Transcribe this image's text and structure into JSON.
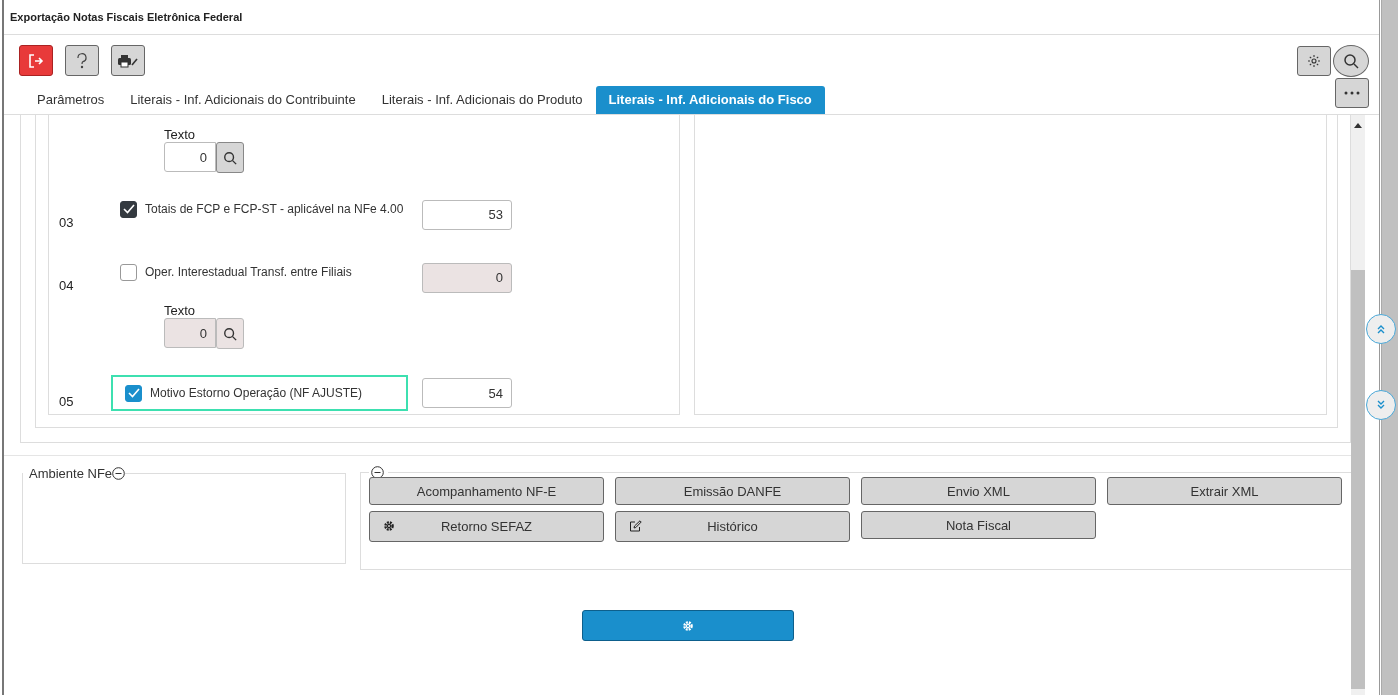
{
  "window": {
    "title": "Exportação Notas Fiscais Eletrônica Federal"
  },
  "tabs": [
    {
      "label": "Parâmetros",
      "selected": false
    },
    {
      "label": "Literais - Inf. Adicionais do Contribuinte",
      "selected": false
    },
    {
      "label": "Literais - Inf. Adicionais do Produto",
      "selected": false
    },
    {
      "label": "Literais - Inf. Adicionais do Fisco",
      "selected": true
    }
  ],
  "items": [
    {
      "kind": "texto",
      "label": "Texto",
      "value": "0",
      "disabled": false
    },
    {
      "kind": "option",
      "number": "03",
      "label": "Totais de FCP e FCP-ST - aplicável na NFe 4.00",
      "checked": true,
      "value": "53",
      "disabled": false,
      "focused": false
    },
    {
      "kind": "option",
      "number": "04",
      "label": "Oper. Interestadual Transf. entre Filiais",
      "checked": false,
      "value": "0",
      "disabled": true,
      "focused": false
    },
    {
      "kind": "texto",
      "label": "Texto",
      "value": "0",
      "disabled": true
    },
    {
      "kind": "option",
      "number": "05",
      "label": "Motivo Estorno Operação (NF AJUSTE)",
      "checked": true,
      "value": "54",
      "disabled": false,
      "focused": true
    }
  ],
  "ambiente": {
    "legend": "Ambiente NFe"
  },
  "actions": [
    {
      "label": "Acompanhamento NF-E",
      "kind": "plain"
    },
    {
      "label": "Emissão DANFE",
      "kind": "plain"
    },
    {
      "label": "Envio XML",
      "kind": "plain"
    },
    {
      "label": "Extrair XML",
      "kind": "plain"
    },
    {
      "label": "Retorno SEFAZ",
      "kind": "gear"
    },
    {
      "label": "Histórico",
      "kind": "edit"
    },
    {
      "label": "Nota Fiscal",
      "kind": "plain"
    }
  ]
}
